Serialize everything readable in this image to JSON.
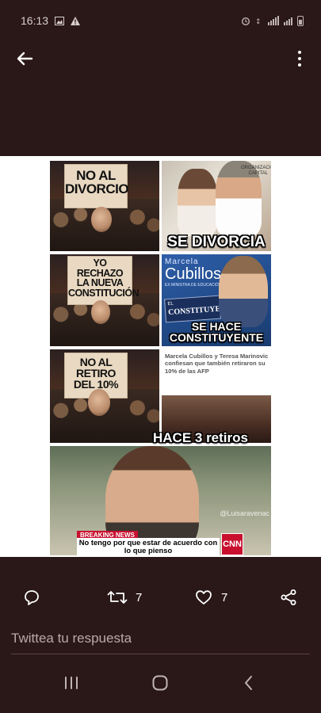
{
  "status_bar": {
    "time": "16:13",
    "icons": [
      "gallery-icon",
      "alert-icon",
      "alarm-icon",
      "wifi-icon",
      "signal-icon",
      "battery-icon"
    ]
  },
  "top_bar": {
    "back_icon": "arrow-left-icon",
    "more_icon": "more-vertical-icon"
  },
  "meme": {
    "panel1": {
      "sign": "NO AL\nDIVORCIO",
      "caption": "SE DIVORCIA"
    },
    "panel2": {
      "sign": "YO\nRECHAZO\nLA NUEVA\nCONSTITUCIÓN",
      "name_first": "Marcela",
      "name_last": "Cubillos",
      "subtitle": "EX MINISTRA DE EDUCACIÓN",
      "banner_prefix": "EL",
      "banner_title": "CONSTITUYENTE",
      "caption_line1": "SE HACE",
      "caption_line2": "CONSTITUYENTE"
    },
    "panel3": {
      "sign": "NO AL\nRETIRO\nDEL 10%",
      "news": "Marcela Cubillos y Teresa Marinovic confiesan que también retiraron su 10% de las AFP",
      "caption": "HACE 3 retiros"
    },
    "panel4": {
      "watermark": "@Luisaravenac",
      "breaking": "BREAKING NEWS",
      "ticker": "No tengo por que estar de acuerdo con lo que pienso",
      "logo": "CNN"
    }
  },
  "actions": {
    "reply_icon": "comment-icon",
    "retweet_icon": "retweet-icon",
    "retweet_count": "7",
    "like_icon": "heart-icon",
    "like_count": "7",
    "share_icon": "share-icon"
  },
  "reply": {
    "placeholder": "Twittea tu respuesta"
  },
  "nav": {
    "recent": "recent-apps-icon",
    "home": "home-icon",
    "back": "back-chevron-icon"
  }
}
